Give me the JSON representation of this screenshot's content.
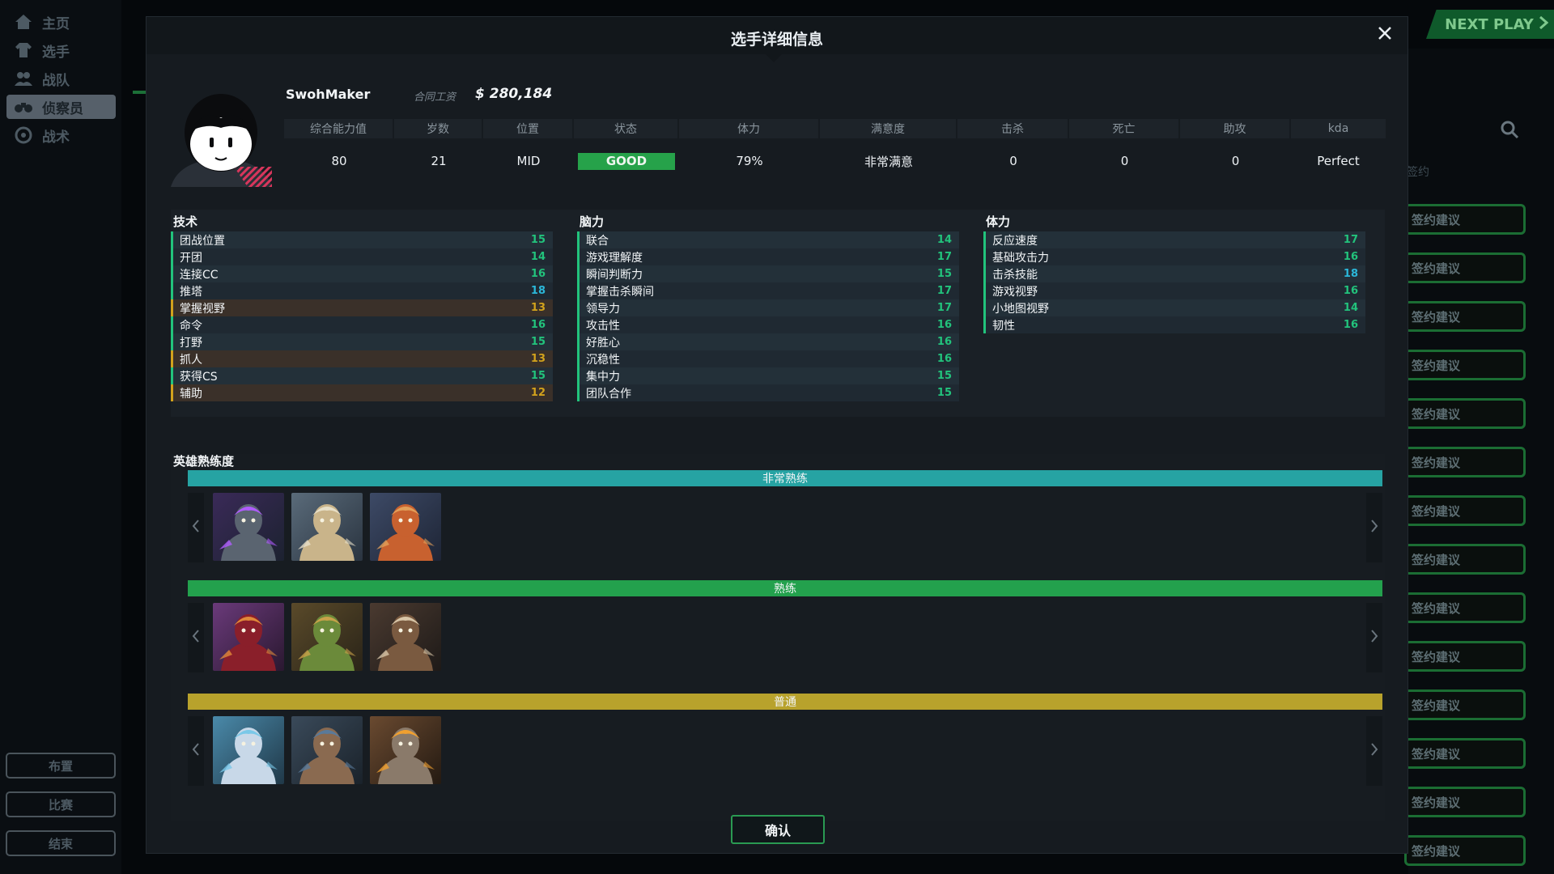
{
  "background": {
    "nav": [
      {
        "label": "主页",
        "icon": "home-icon"
      },
      {
        "label": "选手",
        "icon": "shirt-icon"
      },
      {
        "label": "战队",
        "icon": "team-icon"
      },
      {
        "label": "侦察员",
        "icon": "binoculars-icon"
      },
      {
        "label": "战术",
        "icon": "tactics-icon"
      }
    ],
    "bottom_buttons": [
      "布置",
      "比赛",
      "结束"
    ],
    "next_play": "NEXT PLAY",
    "col_label": "签约",
    "contract_label": "签约建议",
    "contract_count": 14
  },
  "modal": {
    "title": "选手详细信息",
    "player": {
      "name": "SwohMaker",
      "salary_label": "合同工资",
      "salary": "$ 280,184"
    },
    "stats_headers": [
      "综合能力值",
      "岁数",
      "位置",
      "状态",
      "体力",
      "满意度",
      "击杀",
      "死亡",
      "助攻",
      "kda"
    ],
    "stats_values": {
      "overall": "80",
      "age": "21",
      "position": "MID",
      "status": "GOOD",
      "stamina": "79%",
      "satisfaction": "非常满意",
      "kills": "0",
      "deaths": "0",
      "assists": "0",
      "kda": "Perfect"
    },
    "attributes": {
      "technique": {
        "title": "技术",
        "items": [
          {
            "name": "团战位置",
            "value": 15
          },
          {
            "name": "开团",
            "value": 14
          },
          {
            "name": "连接CC",
            "value": 16
          },
          {
            "name": "推塔",
            "value": 18
          },
          {
            "name": "掌握视野",
            "value": 13
          },
          {
            "name": "命令",
            "value": 16
          },
          {
            "name": "打野",
            "value": 15
          },
          {
            "name": "抓人",
            "value": 13
          },
          {
            "name": "获得CS",
            "value": 15
          },
          {
            "name": "辅助",
            "value": 12
          }
        ]
      },
      "mental": {
        "title": "脑力",
        "items": [
          {
            "name": "联合",
            "value": 14
          },
          {
            "name": "游戏理解度",
            "value": 17
          },
          {
            "name": "瞬间判断力",
            "value": 15
          },
          {
            "name": "掌握击杀瞬间",
            "value": 17
          },
          {
            "name": "领导力",
            "value": 17
          },
          {
            "name": "攻击性",
            "value": 16
          },
          {
            "name": "好胜心",
            "value": 16
          },
          {
            "name": "沉稳性",
            "value": 16
          },
          {
            "name": "集中力",
            "value": 15
          },
          {
            "name": "团队合作",
            "value": 15
          }
        ]
      },
      "physical": {
        "title": "体力",
        "items": [
          {
            "name": "反应速度",
            "value": 17
          },
          {
            "name": "基础攻击力",
            "value": 16
          },
          {
            "name": "击杀技能",
            "value": 18
          },
          {
            "name": "游戏视野",
            "value": 16
          },
          {
            "name": "小地图视野",
            "value": 14
          },
          {
            "name": "韧性",
            "value": 16
          }
        ]
      }
    },
    "proficiency": {
      "title": "英雄熟练度",
      "tiers": [
        {
          "label": "非常熟练",
          "color": "#26a3a3",
          "heroes": [
            "hero-stone-golem",
            "hero-armored-knight",
            "hero-red-hair-gunner"
          ]
        },
        {
          "label": "熟练",
          "color": "#23a14d",
          "heroes": [
            "hero-sorceress",
            "hero-crocodile",
            "hero-cowboy"
          ]
        },
        {
          "label": "普通",
          "color": "#b8a22c",
          "heroes": [
            "hero-dragon-rider",
            "hero-brawler",
            "hero-robot"
          ]
        }
      ]
    },
    "confirm_label": "确认"
  }
}
